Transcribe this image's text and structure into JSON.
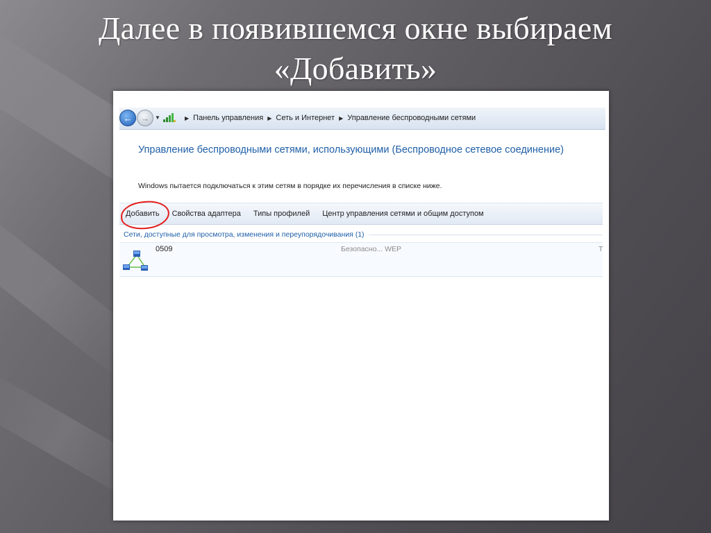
{
  "slide": {
    "title_line1": "Далее в появившемся окне выбираем",
    "title_line2": "«Добавить»"
  },
  "window": {
    "breadcrumbs": [
      "Панель управления",
      "Сеть и Интернет",
      "Управление беспроводными сетями"
    ],
    "heading": "Управление беспроводными сетями, использующими (Беспроводное сетевое соединение)",
    "description": "Windows пытается подключаться к этим сетям в порядке их перечисления в списке ниже.",
    "toolbar": {
      "add": "Добавить",
      "adapter_props": "Свойства адаптера",
      "profile_types": "Типы профилей",
      "network_center": "Центр управления сетями и общим доступом"
    },
    "group_header": "Сети, доступные для просмотра, изменения и переупорядочивания (1)",
    "networks": [
      {
        "name": "0509",
        "security": "Безопасно... WEP",
        "truncated_col": "Т"
      }
    ]
  },
  "colors": {
    "link_blue": "#1f5fa8",
    "highlight_red": "#e21b1b"
  }
}
